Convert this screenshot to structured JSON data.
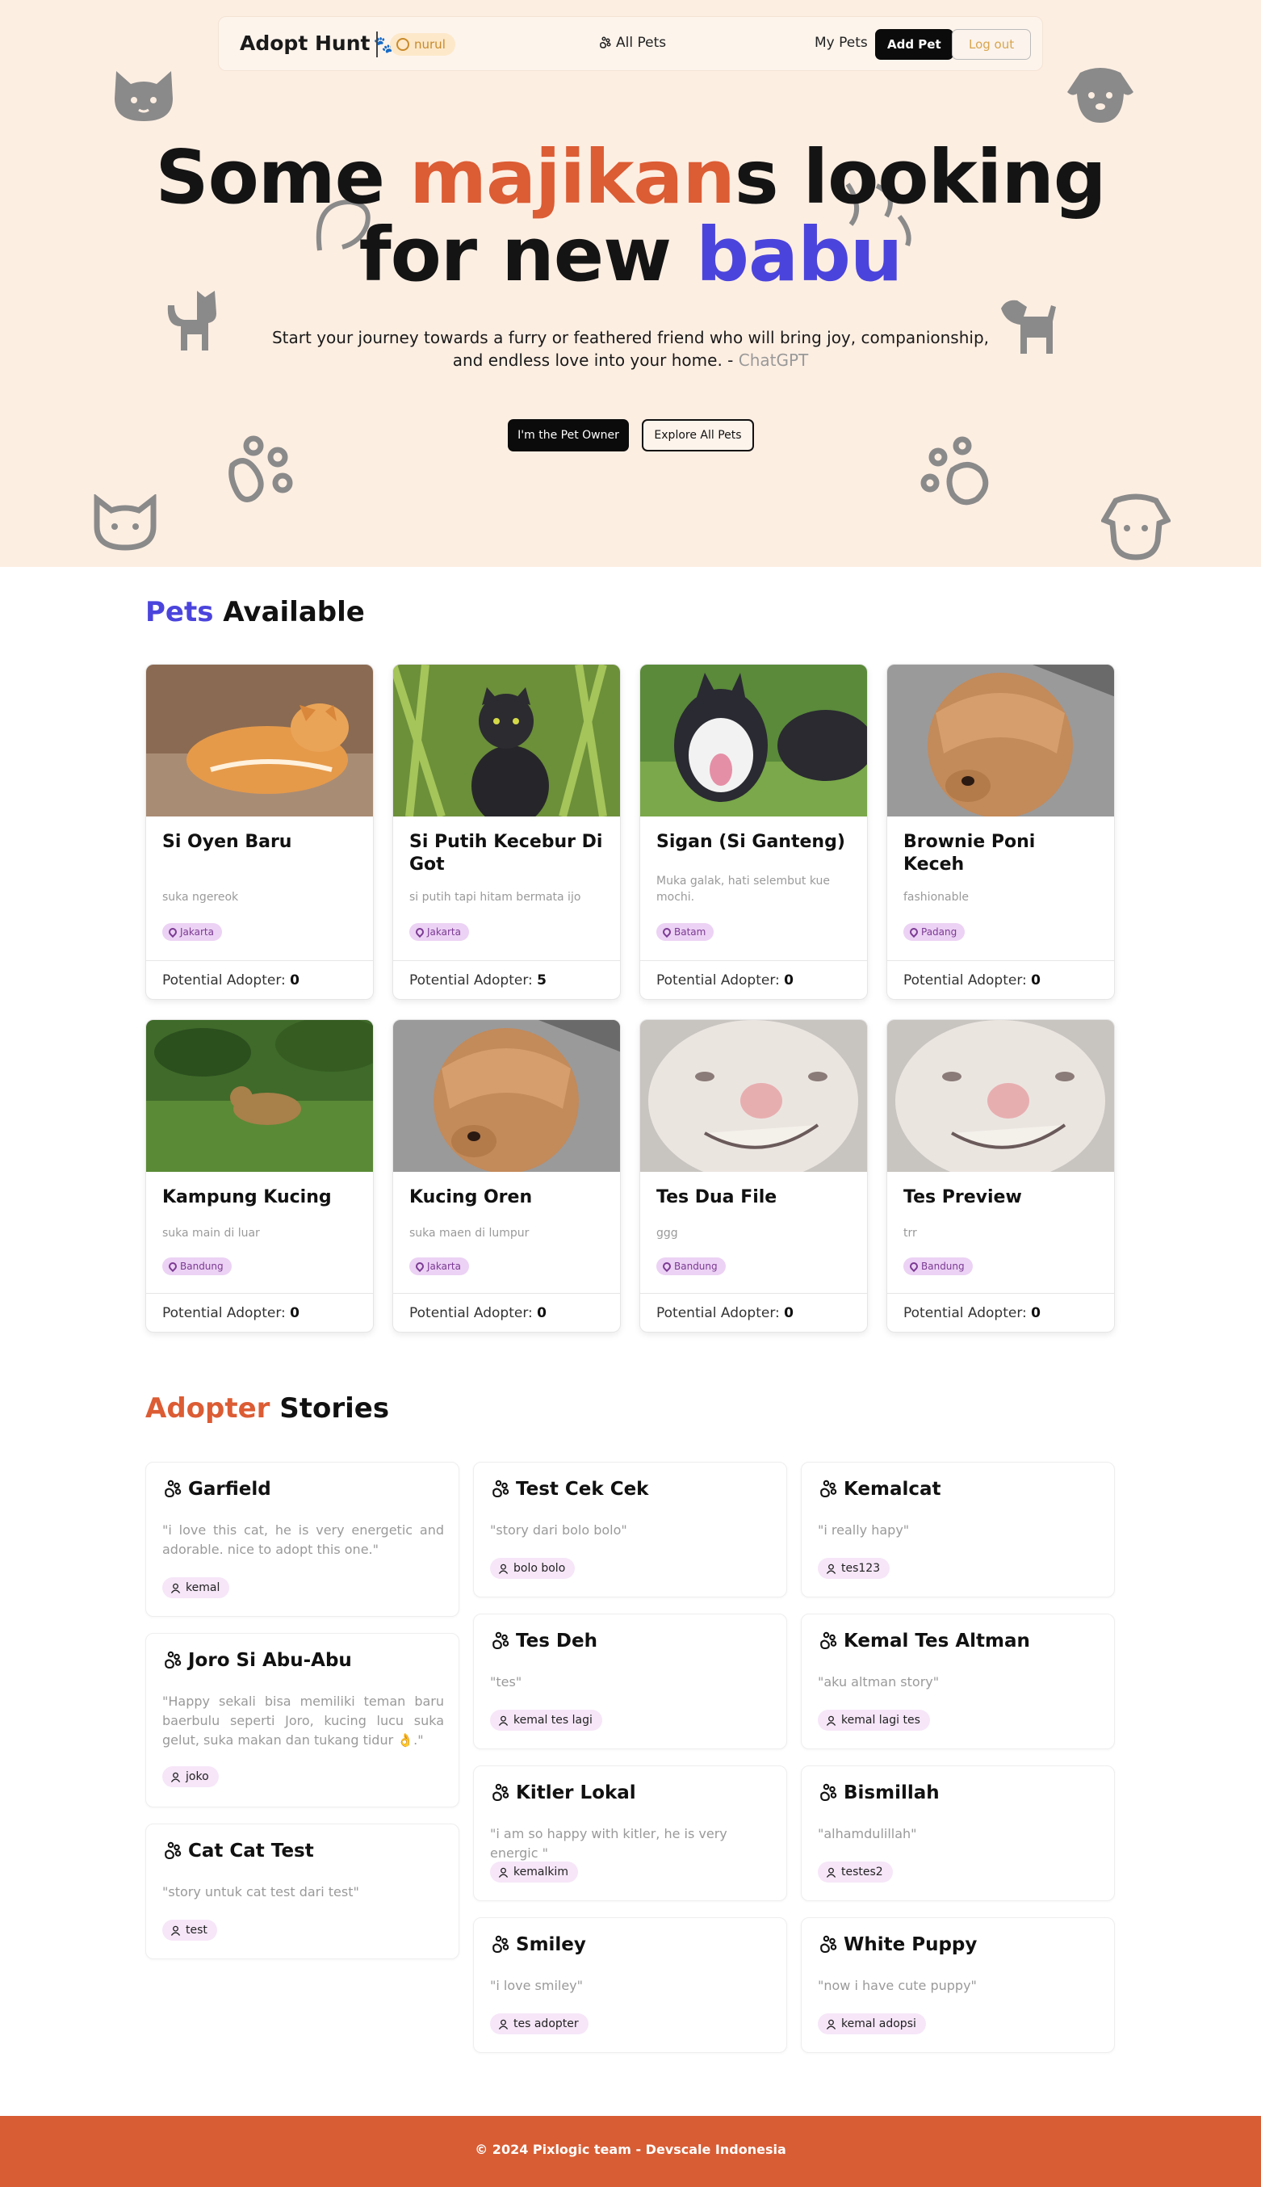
{
  "nav": {
    "logo": "Adopt Hunt",
    "username": "nurul",
    "all_pets": "All Pets",
    "my_pets": "My Pets",
    "add_pet": "Add Pet",
    "logout": "Log out"
  },
  "hero": {
    "title_part1": "Some ",
    "title_highlight1": "majikan",
    "title_part2": "s looking",
    "title_part3": "for new ",
    "title_highlight2": "babu",
    "subtitle": "Start your journey towards a furry or feathered friend who will bring joy, companionship, and endless love into your home. - ",
    "subtitle_credit": "ChatGPT",
    "owner_button": "I'm the Pet Owner",
    "explore_button": "Explore All Pets"
  },
  "pets_section": {
    "title_highlight": "Pets",
    "title_rest": " Available"
  },
  "pets": [
    {
      "name": "Si Oyen Baru",
      "desc": "suka ngereok",
      "loc": "Jakarta",
      "label": "Potential Adopter: ",
      "count": "0"
    },
    {
      "name": "Si Putih Kecebur Di Got",
      "desc": "si putih tapi hitam bermata ijo",
      "loc": "Jakarta",
      "label": "Potential Adopter: ",
      "count": "5"
    },
    {
      "name": "Sigan (Si Ganteng)",
      "desc": "Muka galak, hati selembut kue mochi.",
      "loc": "Batam",
      "label": "Potential Adopter: ",
      "count": "0"
    },
    {
      "name": "Brownie Poni Keceh",
      "desc": "fashionable",
      "loc": "Padang",
      "label": "Potential Adopter: ",
      "count": "0"
    },
    {
      "name": "Kampung Kucing",
      "desc": "suka main di luar",
      "loc": "Bandung",
      "label": "Potential Adopter: ",
      "count": "0"
    },
    {
      "name": "Kucing Oren",
      "desc": "suka maen di lumpur",
      "loc": "Jakarta",
      "label": "Potential Adopter: ",
      "count": "0"
    },
    {
      "name": "Tes Dua File",
      "desc": "ggg",
      "loc": "Bandung",
      "label": "Potential Adopter: ",
      "count": "0"
    },
    {
      "name": "Tes Preview",
      "desc": "trr",
      "loc": "Bandung",
      "label": "Potential Adopter: ",
      "count": "0"
    }
  ],
  "stories_section": {
    "title_highlight": "Adopter",
    "title_rest": " Stories"
  },
  "stories": [
    {
      "title": "Garfield",
      "text": "\"i love this cat, he is very energetic and adorable. nice to adopt this one.\"",
      "user": "kemal"
    },
    {
      "title": "Joro Si Abu-Abu",
      "text": "\"Happy sekali bisa memiliki teman baru baerbulu seperti Joro, kucing lucu suka gelut, suka makan dan tukang tidur 👌.\"",
      "user": "joko"
    },
    {
      "title": "Cat Cat Test",
      "text": "\"story untuk cat test dari test\"",
      "user": "test"
    },
    {
      "title": "Test Cek Cek",
      "text": "\"story dari bolo bolo\"",
      "user": "bolo bolo"
    },
    {
      "title": "Tes Deh",
      "text": "\"tes\"",
      "user": "kemal tes lagi"
    },
    {
      "title": "Kitler Lokal",
      "text": "\"i am so happy with kitler, he is very energic \"",
      "user": "kemalkim"
    },
    {
      "title": "Smiley",
      "text": "\"i love smiley\"",
      "user": "tes adopter"
    },
    {
      "title": "Kemalcat",
      "text": "\"i really hapy\"",
      "user": "tes123"
    },
    {
      "title": "Kemal Tes Altman",
      "text": "\"aku altman story\"",
      "user": "kemal lagi tes"
    },
    {
      "title": "Bismillah",
      "text": "\"alhamdulillah\"",
      "user": "testes2"
    },
    {
      "title": "White Puppy",
      "text": "\"now i have cute puppy\"",
      "user": "kemal adopsi"
    }
  ],
  "footer": {
    "text": "© 2024 Pixlogic team - Devscale Indonesia"
  },
  "colors": {
    "accent_orange": "#dc5c34",
    "accent_blue": "#4b44dc",
    "hero_bg": "#fdeee2",
    "footer_bg": "#d85d34"
  }
}
